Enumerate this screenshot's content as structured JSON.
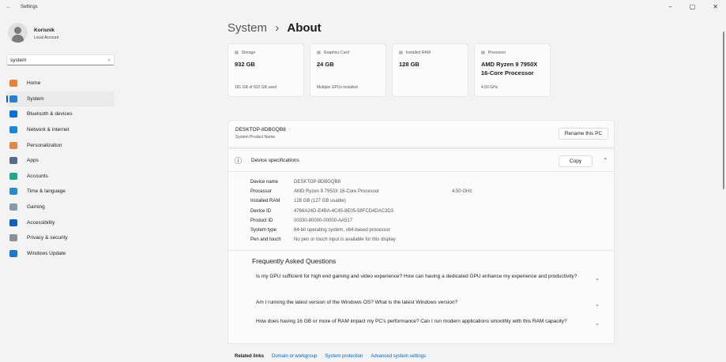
{
  "window": {
    "title": "Settings",
    "back": "←",
    "minimize": "−",
    "maximize": "▢",
    "close": "✕"
  },
  "user": {
    "name": "Korisnik",
    "account": "Local Account"
  },
  "search": {
    "value": "system",
    "icon": "⌕"
  },
  "nav": [
    {
      "label": "Home",
      "color": "#e8813a"
    },
    {
      "label": "System",
      "color": "#2a7dd4"
    },
    {
      "label": "Bluetooth & devices",
      "color": "#0a72d6"
    },
    {
      "label": "Network & internet",
      "color": "#1a86d8"
    },
    {
      "label": "Personalization",
      "color": "#e0884a"
    },
    {
      "label": "Apps",
      "color": "#5a6a8a"
    },
    {
      "label": "Accounts",
      "color": "#22a888"
    },
    {
      "label": "Time & language",
      "color": "#2a8ad0"
    },
    {
      "label": "Gaming",
      "color": "#8a99aa"
    },
    {
      "label": "Accessibility",
      "color": "#1060c0"
    },
    {
      "label": "Privacy & security",
      "color": "#8a8f99"
    },
    {
      "label": "Windows Update",
      "color": "#1a78d0"
    }
  ],
  "header": {
    "parent": "System",
    "sep": "›",
    "title": "About"
  },
  "cards": [
    {
      "label": "Storage",
      "value": "932 GB",
      "sub": "181 GB of 932 GB used"
    },
    {
      "label": "Graphics Card",
      "value": "24 GB",
      "sub": "Multiple GPUs installed"
    },
    {
      "label": "Installed RAM",
      "value": "128 GB",
      "sub": ""
    },
    {
      "label": "Processor",
      "value": "AMD Ryzen 9 7950X 16-Core Processor",
      "sub": "4.50 GHz"
    }
  ],
  "pc": {
    "name": "DESKTOP-8DBGQB8",
    "caption": "System Product Name",
    "rename": "Rename this PC"
  },
  "specs": {
    "title": "Device specifications",
    "copy": "Copy",
    "info_icon": "ⓘ",
    "collapse": "⌃",
    "rows": [
      {
        "k": "Device name",
        "v": "DESKTOP-8DBGQB8",
        "x": ""
      },
      {
        "k": "Processor",
        "v": "AMD Ryzen 9 7950X 16-Core Processor",
        "x": "4.50 GHz"
      },
      {
        "k": "Installed RAM",
        "v": "128 GB (127 GB usable)",
        "x": ""
      },
      {
        "k": "Device ID",
        "v": "4766A24D-E4BA-4C45-8E05-58FCD4DAC3D3",
        "x": ""
      },
      {
        "k": "Product ID",
        "v": "00330-80000-00000-AA517",
        "x": ""
      },
      {
        "k": "System type",
        "v": "64-bit operating system, x64-based processor",
        "x": ""
      },
      {
        "k": "Pen and touch",
        "v": "No pen or touch input is available for this display",
        "x": ""
      }
    ]
  },
  "faq": {
    "title": "Frequently Asked Questions",
    "items": [
      "Is my GPU sufficient for high end gaming and video experience? How can having a dedicated GPU enhance my experience and productivity?",
      "Am I running the latest version of the Windows OS? What is the latest Windows version?",
      "How does having 16 GB or more of RAM impact my PC's performance? Can I run modern applications smoothly with this RAM capacity?"
    ],
    "chevron": "⌄"
  },
  "related": {
    "label": "Related links",
    "links": [
      "Domain or workgroup",
      "System protection",
      "Advanced system settings"
    ]
  }
}
